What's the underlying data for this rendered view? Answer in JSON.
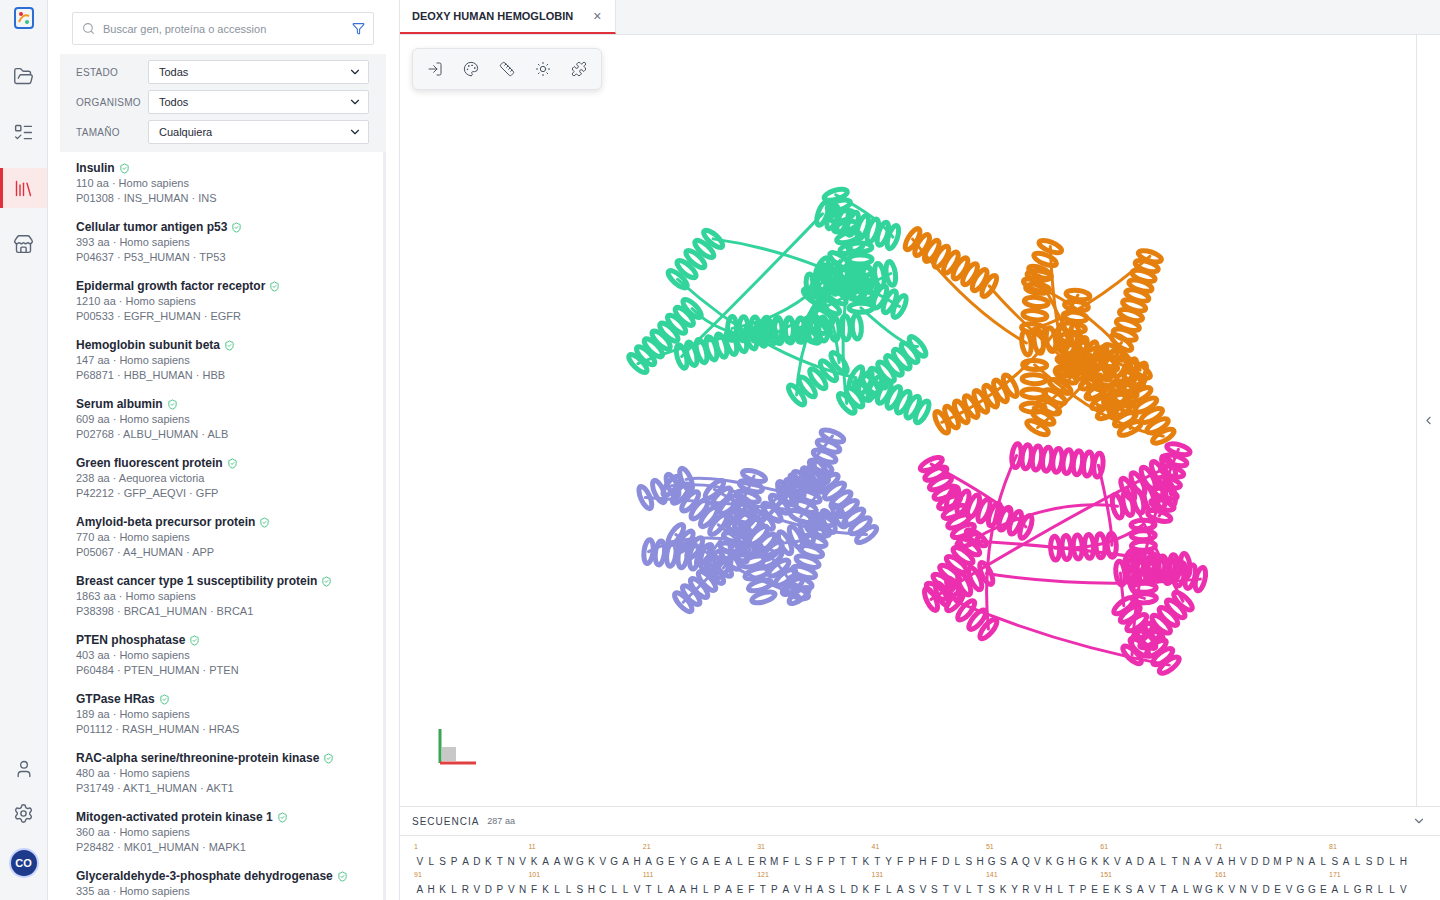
{
  "rail": {
    "items": [
      {
        "selected": false
      },
      {
        "selected": false
      },
      {
        "selected": true
      },
      {
        "selected": false
      }
    ],
    "avatar": "CO"
  },
  "search": {
    "placeholder": "Buscar gen, proteína o accession"
  },
  "filters": [
    {
      "label": "ESTADO",
      "value": "Todas"
    },
    {
      "label": "ORGANISMO",
      "value": "Todos"
    },
    {
      "label": "TAMAÑO",
      "value": "Cualquiera"
    }
  ],
  "proteins": [
    {
      "name": "Insulin",
      "verified": true,
      "meta": "110 aa · Homo sapiens",
      "ids": "P01308 · INS_HUMAN · INS"
    },
    {
      "name": "Cellular tumor antigen p53",
      "verified": true,
      "meta": "393 aa · Homo sapiens",
      "ids": "P04637 · P53_HUMAN · TP53"
    },
    {
      "name": "Epidermal growth factor receptor",
      "verified": true,
      "meta": "1210 aa · Homo sapiens",
      "ids": "P00533 · EGFR_HUMAN · EGFR"
    },
    {
      "name": "Hemoglobin subunit beta",
      "verified": true,
      "meta": "147 aa · Homo sapiens",
      "ids": "P68871 · HBB_HUMAN · HBB"
    },
    {
      "name": "Serum albumin",
      "verified": true,
      "meta": "609 aa · Homo sapiens",
      "ids": "P02768 · ALBU_HUMAN · ALB"
    },
    {
      "name": "Green fluorescent protein",
      "verified": true,
      "meta": "238 aa · Aequorea victoria",
      "ids": "P42212 · GFP_AEQVI · GFP"
    },
    {
      "name": "Amyloid-beta precursor protein",
      "verified": true,
      "meta": "770 aa · Homo sapiens",
      "ids": "P05067 · A4_HUMAN · APP"
    },
    {
      "name": "Breast cancer type 1 susceptibility protein",
      "verified": true,
      "meta": "1863 aa · Homo sapiens",
      "ids": "P38398 · BRCA1_HUMAN · BRCA1"
    },
    {
      "name": "PTEN phosphatase",
      "verified": true,
      "meta": "403 aa · Homo sapiens",
      "ids": "P60484 · PTEN_HUMAN · PTEN"
    },
    {
      "name": "GTPase HRas",
      "verified": true,
      "meta": "189 aa · Homo sapiens",
      "ids": "P01112 · RASH_HUMAN · HRAS"
    },
    {
      "name": "RAC-alpha serine/threonine-protein kinase",
      "verified": true,
      "meta": "480 aa · Homo sapiens",
      "ids": "P31749 · AKT1_HUMAN · AKT1"
    },
    {
      "name": "Mitogen-activated protein kinase 1",
      "verified": true,
      "meta": "360 aa · Homo sapiens",
      "ids": "P28482 · MK01_HUMAN · MAPK1"
    },
    {
      "name": "Glyceraldehyde-3-phosphate dehydrogenase",
      "verified": true,
      "meta": "335 aa · Homo sapiens",
      "ids": ""
    }
  ],
  "tabs": [
    {
      "label": "DEOXY HUMAN HEMOGLOBIN",
      "selected": true,
      "close": "×"
    }
  ],
  "structure": {
    "chains": [
      {
        "color": "#8c8ddb"
      },
      {
        "color": "#e5800f"
      },
      {
        "color": "#33d39c"
      },
      {
        "color": "#ec2fae"
      }
    ]
  },
  "sequence": {
    "title": "SECUENCIA",
    "count": "287 aa",
    "rows": [
      {
        "ticks": [
          "1",
          "11",
          "21",
          "31",
          "41",
          "51",
          "61",
          "71",
          "81"
        ],
        "residues": "VLSPADKTNVKAAWGKVGAHAGEYGAEALERMFLSFPTTKTYFPHFDLSHGSAQVKGHGKKVADALTNAVAHVDDMPNALSALSDLH"
      },
      {
        "ticks": [
          "91",
          "101",
          "111",
          "121",
          "131",
          "141",
          "151",
          "161",
          "171"
        ],
        "residues": "AHKLRVDPVNFKLLSHCLLVTLAAHLPAEFTPAVHASLDKFLASVSTVLTSKYRVHLTPEEKSAVTALWGKVNVDEVGGEALGRLLV"
      }
    ]
  }
}
